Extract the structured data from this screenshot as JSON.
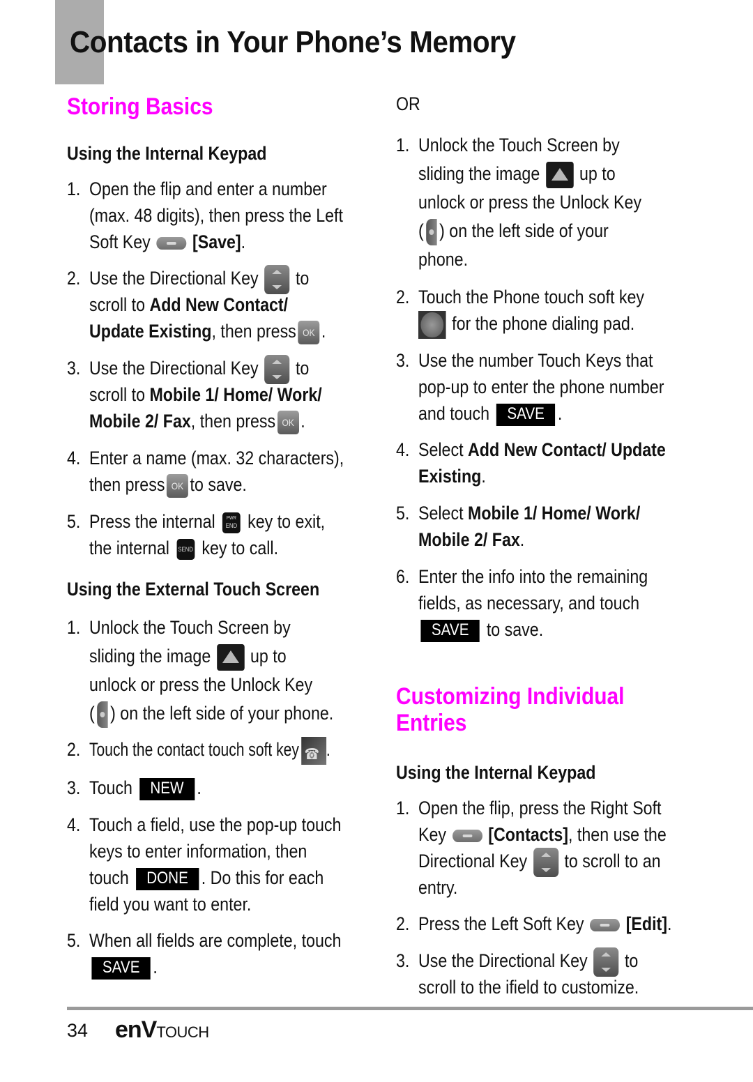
{
  "page": {
    "title": "Contacts in Your Phone’s Memory",
    "accent_color": "#ff00ff",
    "tab_color": "#acacac"
  },
  "left": {
    "section_heading": "Storing Basics",
    "internal_keypad": {
      "heading": "Using the Internal Keypad",
      "steps": [
        {
          "num": "1.",
          "lines": [
            "Open the flip and enter a number",
            "(max. 48 digits), then press the Left",
            "Soft Key"
          ],
          "bold": "[Save]",
          "icon": "left-soft-key-icon"
        },
        {
          "num": "2.",
          "pre": "Use the Directional Key",
          "post": "to",
          "line2_pre": "scroll to ",
          "line2_bold": "Add New Contact/",
          "line3_bold": "Update Existing",
          "line3_post": ", then press",
          "icon1": "directional-key-icon",
          "icon2": "ok-key-icon"
        },
        {
          "num": "3.",
          "pre": "Use the Directional Key",
          "post": "to",
          "line2_pre": "scroll to ",
          "line2_bold": "Mobile 1/ Home/ Work/",
          "line3_bold": "Mobile 2/ Fax",
          "line3_post": ", then press",
          "icon1": "directional-key-icon",
          "icon2": "ok-key-icon"
        },
        {
          "num": "4.",
          "line1": "Enter a name (max. 32 characters),",
          "line2_pre": "then press",
          "line2_post": "to save.",
          "icon": "ok-key-icon"
        },
        {
          "num": "5.",
          "line1_pre": "Press the internal",
          "line1_post": "key to exit,",
          "line2_pre": "the internal",
          "line2_post": "key to call.",
          "icon1_label_top": "PWR",
          "icon1_label": "END",
          "icon2_label": "SEND"
        }
      ]
    },
    "external_touch": {
      "heading": "Using the External Touch Screen",
      "steps": [
        {
          "num": "1.",
          "line1": "Unlock the Touch Screen by",
          "line2_pre": "sliding the image",
          "line2_post": "up to",
          "line3": "unlock or press the Unlock Key",
          "line4_pre": "(",
          "line4_post": ") on the left side of your phone."
        },
        {
          "num": "2.",
          "text": "Touch the contact touch soft key",
          "post": "."
        },
        {
          "num": "3.",
          "text": "Touch",
          "button": "NEW",
          "post": "."
        },
        {
          "num": "4.",
          "line1": "Touch a field, use the pop-up touch",
          "line2": "keys to enter information, then",
          "line3_pre": "touch",
          "button": "DONE",
          "line3_post": ". Do this for each",
          "line4": "field you want to enter."
        },
        {
          "num": "5.",
          "line1": "When all fields are complete, touch",
          "button": "SAVE",
          "post": "."
        }
      ]
    }
  },
  "right": {
    "or_label": "OR",
    "touch_steps": [
      {
        "num": "1.",
        "line1": "Unlock the Touch Screen by",
        "line2_pre": "sliding the image",
        "line2_post": "up to",
        "line3": "unlock or press the Unlock Key",
        "line4_pre": "(",
        "line4_post": ") on the left side of your",
        "line5": "phone."
      },
      {
        "num": "2.",
        "line1": "Touch the Phone touch soft key",
        "line2": "for the phone dialing pad."
      },
      {
        "num": "3.",
        "line1": "Use the number Touch Keys that",
        "line2": "pop-up to enter the phone number",
        "line3_pre": "and touch",
        "button": "SAVE",
        "post": "."
      },
      {
        "num": "4.",
        "pre": "Select ",
        "bold1": "Add New Contact/ Update",
        "bold2": "Existing",
        "post": "."
      },
      {
        "num": "5.",
        "pre": "Select ",
        "bold1": "Mobile 1/ Home/ Work/",
        "bold2": "Mobile 2/ Fax",
        "post": "."
      },
      {
        "num": "6.",
        "line1": "Enter the info into the remaining",
        "line2": "fields, as necessary, and touch",
        "button": "SAVE",
        "post": "to save."
      }
    ],
    "section_heading_line1": "Customizing Individual",
    "section_heading_line2": "Entries",
    "internal_keypad": {
      "heading": "Using the Internal Keypad",
      "steps": [
        {
          "num": "1.",
          "line1": "Open the flip, press the Right Soft",
          "line2_pre": "Key",
          "line2_bold": "[Contacts]",
          "line2_post": ", then use the",
          "line3_pre": "Directional Key",
          "line3_post": "to scroll to an",
          "line4": "entry."
        },
        {
          "num": "2.",
          "pre": "Press the Left Soft Key",
          "bold": "[Edit]",
          "post": "."
        },
        {
          "num": "3.",
          "pre": "Use the Directional Key",
          "post": "to",
          "line2": "scroll to the ifield to customize."
        }
      ]
    }
  },
  "footer": {
    "page_number": "34",
    "brand_env": "enV",
    "brand_touch": "TOUCH"
  }
}
